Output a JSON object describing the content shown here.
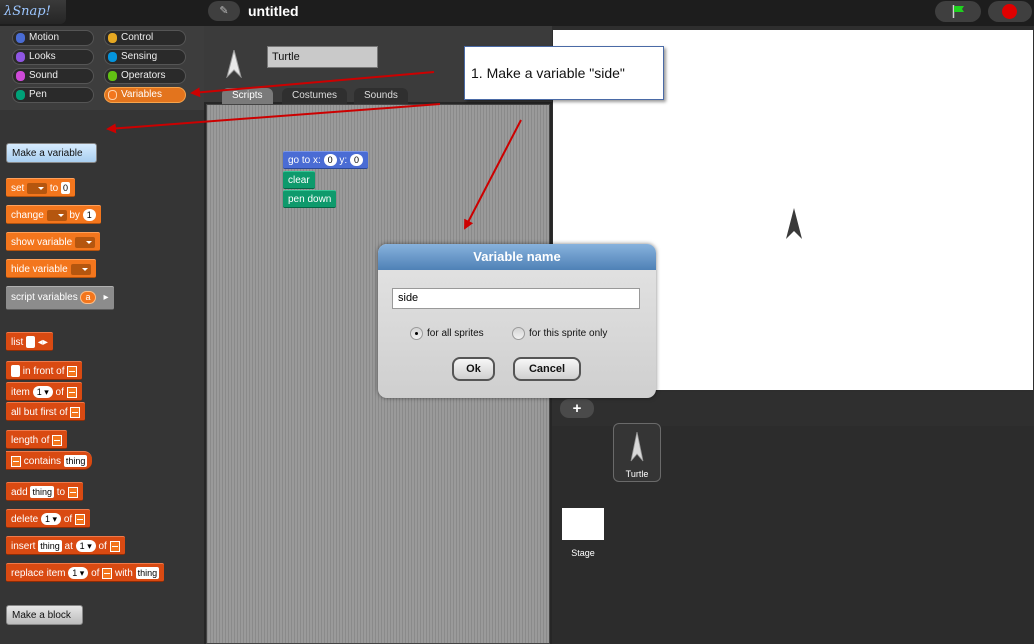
{
  "app": {
    "logo": "λSnap!",
    "project_title": "untitled"
  },
  "categories": [
    {
      "label": "Motion",
      "color": "#4a6cd4"
    },
    {
      "label": "Control",
      "color": "#e6a822"
    },
    {
      "label": "Looks",
      "color": "#8f56e3"
    },
    {
      "label": "Sensing",
      "color": "#0494dc"
    },
    {
      "label": "Sound",
      "color": "#cf4ad9"
    },
    {
      "label": "Operators",
      "color": "#62c213"
    },
    {
      "label": "Pen",
      "color": "#00a178"
    },
    {
      "label": "Variables",
      "color": "#f3761d"
    }
  ],
  "palette": {
    "make_variable": "Make a variable",
    "make_block": "Make a block",
    "set": {
      "a": "set",
      "b": "to",
      "v": "0"
    },
    "change": {
      "a": "change",
      "b": "by",
      "v": "1"
    },
    "show_variable": "show variable",
    "hide_variable": "hide variable",
    "script_variables": {
      "a": "script variables",
      "v": "a"
    },
    "list": "list",
    "in_front_of": "in front of",
    "item": {
      "a": "item",
      "v": "1",
      "b": "of"
    },
    "all_but_first": "all but first of",
    "length_of": "length of",
    "contains": {
      "a": "contains",
      "v": "thing"
    },
    "add": {
      "a": "add",
      "v": "thing",
      "b": "to"
    },
    "delete": {
      "a": "delete",
      "v": "1",
      "b": "of"
    },
    "insert": {
      "a": "insert",
      "v": "thing",
      "b": "at",
      "v2": "1",
      "c": "of"
    },
    "replace": {
      "a": "replace item",
      "v": "1",
      "b": "of",
      "c": "with",
      "v2": "thing"
    }
  },
  "editor": {
    "sprite_name": "Turtle",
    "tabs": [
      "Scripts",
      "Costumes",
      "Sounds"
    ],
    "script": {
      "goto": {
        "a": "go to x:",
        "x": "0",
        "b": "y:",
        "y": "0"
      },
      "clear": "clear",
      "pen_down": "pen down"
    }
  },
  "callout": "1. Make a variable \"side\"",
  "dialog": {
    "title": "Variable name",
    "value": "side",
    "radio_all": "for all sprites",
    "radio_this": "for this sprite only",
    "ok": "Ok",
    "cancel": "Cancel"
  },
  "corral": {
    "add": "+",
    "sprite_label": "Turtle",
    "stage_label": "Stage"
  }
}
